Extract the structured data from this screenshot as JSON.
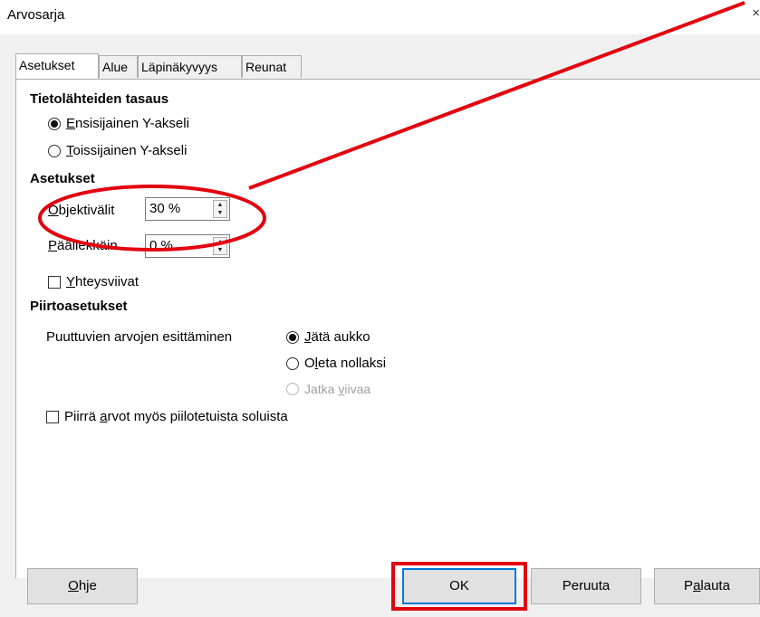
{
  "window": {
    "title": "Arvosarja",
    "close_glyph": "×"
  },
  "tabs": [
    {
      "label": "Asetukset",
      "active": true
    },
    {
      "label": "Alue",
      "active": false
    },
    {
      "label": "Läpinäkyvyys",
      "active": false
    },
    {
      "label": "Reunat",
      "active": false
    }
  ],
  "align": {
    "heading": "Tietolähteiden tasaus",
    "primary_mn": "E",
    "primary_rest": "nsisijainen Y-akseli",
    "secondary_mn": "T",
    "secondary_rest": "oissijainen Y-akseli",
    "selected": "primary"
  },
  "settings": {
    "heading": "Asetukset",
    "gap_label_mn": "O",
    "gap_label_rest": "bjektivälit",
    "gap_value": "30 %",
    "overlap_label_mn": "P",
    "overlap_label_rest": "äällekkäin",
    "overlap_value": "0 %",
    "connection_mn": "Y",
    "connection_rest": "hteysviivat",
    "connection_checked": false
  },
  "plot": {
    "heading": "Piirtoasetukset",
    "missing_label": "Puuttuvien arvojen esittäminen",
    "leave_gap_mn": "J",
    "leave_gap_rest": "ätä aukko",
    "assume_zero_a": "O",
    "assume_zero_mn": "l",
    "assume_zero_rest": "eta nollaksi",
    "continue_a": "Jatka ",
    "continue_mn": "v",
    "continue_rest": "iivaa",
    "selected": "leave_gap",
    "hidden_a": "Piirrä ",
    "hidden_mn": "a",
    "hidden_rest": "rvot myös piilotetuista soluista",
    "hidden_checked": false
  },
  "buttons": {
    "help_mn": "O",
    "help_rest": "hje",
    "ok": "OK",
    "cancel": "Peruuta",
    "reset_a": "P",
    "reset_mn": "a",
    "reset_rest": "lauta"
  },
  "colors": {
    "annotation": "#e3000f",
    "default_button_border": "#0078d7",
    "dialog_bg": "#f0f0f0"
  }
}
